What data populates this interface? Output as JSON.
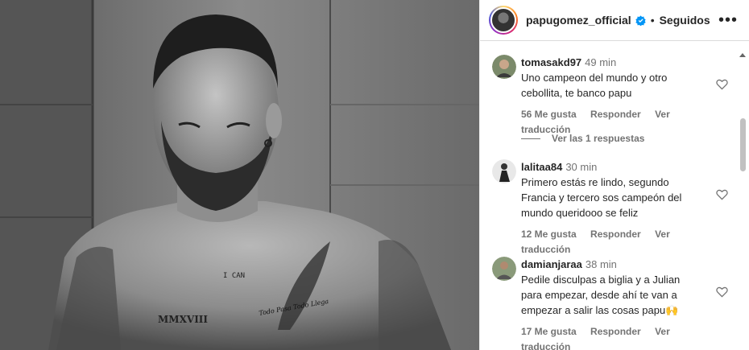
{
  "post": {
    "photo_alt": "black and white shirtless man with tattoos",
    "tattoos": {
      "chest": "I CAN",
      "stomach": "MMXVIII",
      "arm_script": "Todo Pasa Todo Llega"
    }
  },
  "header": {
    "username": "papugomez_official",
    "follow_state": "Seguidos",
    "separator": "•",
    "more": "•••"
  },
  "comments": [
    {
      "user": "tomasakd97",
      "time": "49 min",
      "text": "Uno campeon del mundo y otro cebollita, te banco papu",
      "likes": "56 Me gusta",
      "reply": "Responder",
      "translate": "Ver traducción"
    },
    {
      "user": "lalitaa84",
      "time": "30 min",
      "text": "Primero estás re lindo, segundo Francia y tercero sos campeón del mundo queridooo se feliz",
      "likes": "12 Me gusta",
      "reply": "Responder",
      "translate": "Ver traducción"
    },
    {
      "user": "damianjaraa",
      "time": "38 min",
      "text": "Pedile disculpas a biglia y a Julian para empezar, desde ahí te van a empezar a salir las cosas papu🙌",
      "likes": "17 Me gusta",
      "reply": "Responder",
      "translate": "Ver traducción"
    }
  ],
  "replies_link": "Ver las 1 respuestas",
  "colors": {
    "verified": "#0095f6",
    "meta": "#737373",
    "text": "#262626"
  }
}
